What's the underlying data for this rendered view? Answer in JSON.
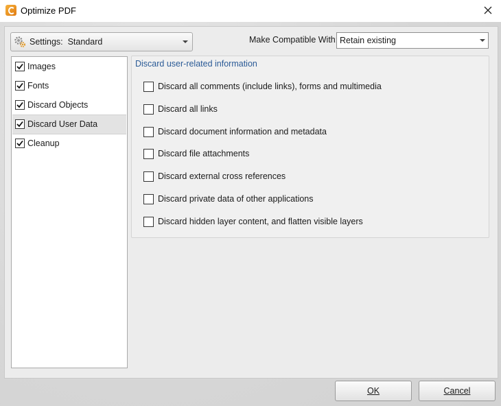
{
  "window": {
    "title": "Optimize PDF",
    "close_icon": "close-icon",
    "app_icon": "app-icon"
  },
  "settings": {
    "label": "Settings:",
    "value": "Standard",
    "icon": "gear-icon"
  },
  "compat": {
    "label": "Make Compatible With:",
    "value": "Retain existing"
  },
  "nav": {
    "items": [
      {
        "label": "Images",
        "checked": true,
        "selected": false
      },
      {
        "label": "Fonts",
        "checked": true,
        "selected": false
      },
      {
        "label": "Discard Objects",
        "checked": true,
        "selected": false
      },
      {
        "label": "Discard User Data",
        "checked": true,
        "selected": true
      },
      {
        "label": "Cleanup",
        "checked": true,
        "selected": false
      }
    ]
  },
  "group": {
    "title": "Discard user-related information",
    "options": [
      {
        "label": "Discard all comments (include links), forms and multimedia",
        "checked": false
      },
      {
        "label": "Discard all links",
        "checked": false
      },
      {
        "label": "Discard document information and metadata",
        "checked": false
      },
      {
        "label": "Discard file attachments",
        "checked": false
      },
      {
        "label": "Discard external cross references",
        "checked": false
      },
      {
        "label": "Discard private data of other applications",
        "checked": false
      },
      {
        "label": "Discard hidden layer content, and flatten visible layers",
        "checked": false
      }
    ]
  },
  "buttons": {
    "ok": "OK",
    "cancel": "Cancel"
  },
  "colors": {
    "group_title": "#2a5a96",
    "selected_row": "#e3e3e3"
  }
}
